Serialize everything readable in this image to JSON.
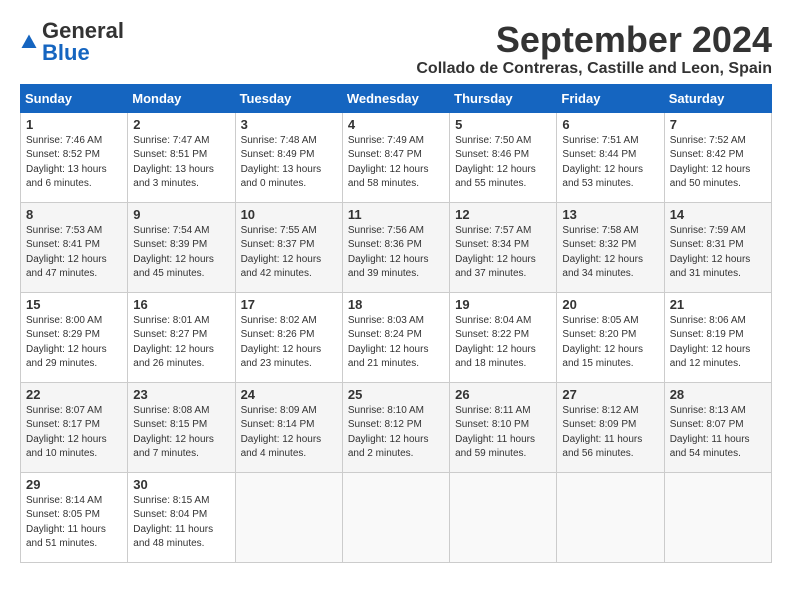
{
  "header": {
    "logo_general": "General",
    "logo_blue": "Blue",
    "month_title": "September 2024",
    "location": "Collado de Contreras, Castille and Leon, Spain"
  },
  "days_of_week": [
    "Sunday",
    "Monday",
    "Tuesday",
    "Wednesday",
    "Thursday",
    "Friday",
    "Saturday"
  ],
  "weeks": [
    [
      {
        "day": "1",
        "info": "Sunrise: 7:46 AM\nSunset: 8:52 PM\nDaylight: 13 hours\nand 6 minutes."
      },
      {
        "day": "2",
        "info": "Sunrise: 7:47 AM\nSunset: 8:51 PM\nDaylight: 13 hours\nand 3 minutes."
      },
      {
        "day": "3",
        "info": "Sunrise: 7:48 AM\nSunset: 8:49 PM\nDaylight: 13 hours\nand 0 minutes."
      },
      {
        "day": "4",
        "info": "Sunrise: 7:49 AM\nSunset: 8:47 PM\nDaylight: 12 hours\nand 58 minutes."
      },
      {
        "day": "5",
        "info": "Sunrise: 7:50 AM\nSunset: 8:46 PM\nDaylight: 12 hours\nand 55 minutes."
      },
      {
        "day": "6",
        "info": "Sunrise: 7:51 AM\nSunset: 8:44 PM\nDaylight: 12 hours\nand 53 minutes."
      },
      {
        "day": "7",
        "info": "Sunrise: 7:52 AM\nSunset: 8:42 PM\nDaylight: 12 hours\nand 50 minutes."
      }
    ],
    [
      {
        "day": "8",
        "info": "Sunrise: 7:53 AM\nSunset: 8:41 PM\nDaylight: 12 hours\nand 47 minutes."
      },
      {
        "day": "9",
        "info": "Sunrise: 7:54 AM\nSunset: 8:39 PM\nDaylight: 12 hours\nand 45 minutes."
      },
      {
        "day": "10",
        "info": "Sunrise: 7:55 AM\nSunset: 8:37 PM\nDaylight: 12 hours\nand 42 minutes."
      },
      {
        "day": "11",
        "info": "Sunrise: 7:56 AM\nSunset: 8:36 PM\nDaylight: 12 hours\nand 39 minutes."
      },
      {
        "day": "12",
        "info": "Sunrise: 7:57 AM\nSunset: 8:34 PM\nDaylight: 12 hours\nand 37 minutes."
      },
      {
        "day": "13",
        "info": "Sunrise: 7:58 AM\nSunset: 8:32 PM\nDaylight: 12 hours\nand 34 minutes."
      },
      {
        "day": "14",
        "info": "Sunrise: 7:59 AM\nSunset: 8:31 PM\nDaylight: 12 hours\nand 31 minutes."
      }
    ],
    [
      {
        "day": "15",
        "info": "Sunrise: 8:00 AM\nSunset: 8:29 PM\nDaylight: 12 hours\nand 29 minutes."
      },
      {
        "day": "16",
        "info": "Sunrise: 8:01 AM\nSunset: 8:27 PM\nDaylight: 12 hours\nand 26 minutes."
      },
      {
        "day": "17",
        "info": "Sunrise: 8:02 AM\nSunset: 8:26 PM\nDaylight: 12 hours\nand 23 minutes."
      },
      {
        "day": "18",
        "info": "Sunrise: 8:03 AM\nSunset: 8:24 PM\nDaylight: 12 hours\nand 21 minutes."
      },
      {
        "day": "19",
        "info": "Sunrise: 8:04 AM\nSunset: 8:22 PM\nDaylight: 12 hours\nand 18 minutes."
      },
      {
        "day": "20",
        "info": "Sunrise: 8:05 AM\nSunset: 8:20 PM\nDaylight: 12 hours\nand 15 minutes."
      },
      {
        "day": "21",
        "info": "Sunrise: 8:06 AM\nSunset: 8:19 PM\nDaylight: 12 hours\nand 12 minutes."
      }
    ],
    [
      {
        "day": "22",
        "info": "Sunrise: 8:07 AM\nSunset: 8:17 PM\nDaylight: 12 hours\nand 10 minutes."
      },
      {
        "day": "23",
        "info": "Sunrise: 8:08 AM\nSunset: 8:15 PM\nDaylight: 12 hours\nand 7 minutes."
      },
      {
        "day": "24",
        "info": "Sunrise: 8:09 AM\nSunset: 8:14 PM\nDaylight: 12 hours\nand 4 minutes."
      },
      {
        "day": "25",
        "info": "Sunrise: 8:10 AM\nSunset: 8:12 PM\nDaylight: 12 hours\nand 2 minutes."
      },
      {
        "day": "26",
        "info": "Sunrise: 8:11 AM\nSunset: 8:10 PM\nDaylight: 11 hours\nand 59 minutes."
      },
      {
        "day": "27",
        "info": "Sunrise: 8:12 AM\nSunset: 8:09 PM\nDaylight: 11 hours\nand 56 minutes."
      },
      {
        "day": "28",
        "info": "Sunrise: 8:13 AM\nSunset: 8:07 PM\nDaylight: 11 hours\nand 54 minutes."
      }
    ],
    [
      {
        "day": "29",
        "info": "Sunrise: 8:14 AM\nSunset: 8:05 PM\nDaylight: 11 hours\nand 51 minutes."
      },
      {
        "day": "30",
        "info": "Sunrise: 8:15 AM\nSunset: 8:04 PM\nDaylight: 11 hours\nand 48 minutes."
      },
      {
        "day": "",
        "info": ""
      },
      {
        "day": "",
        "info": ""
      },
      {
        "day": "",
        "info": ""
      },
      {
        "day": "",
        "info": ""
      },
      {
        "day": "",
        "info": ""
      }
    ]
  ]
}
